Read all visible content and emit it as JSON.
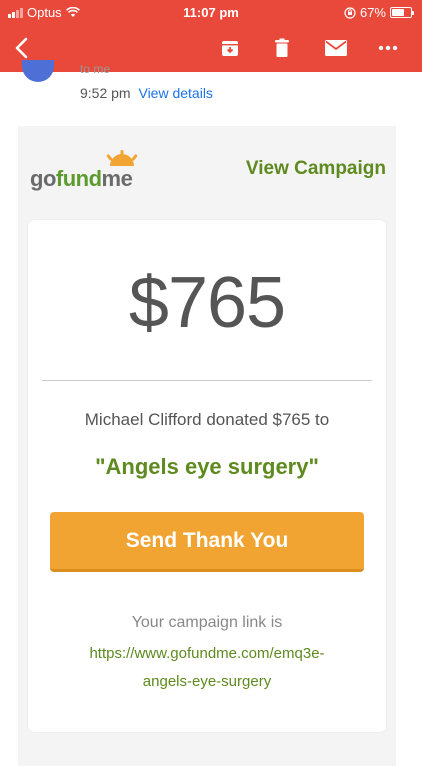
{
  "status_bar": {
    "carrier": "Optus",
    "time": "11:07 pm",
    "battery": "67%",
    "battery_level": 0.67
  },
  "toolbar": {
    "back_icon": "chevron-left-icon",
    "archive_icon": "archive-icon",
    "delete_icon": "trash-icon",
    "mark_icon": "envelope-icon",
    "more_icon": "more-icon"
  },
  "email_header": {
    "to_line": "to me",
    "time": "9:52 pm",
    "view_details": "View details"
  },
  "email_body": {
    "logo": "gofundme",
    "view_campaign": "View Campaign",
    "amount": "$765",
    "donation_text": "Michael Clifford donated $765 to",
    "campaign_name": "\"Angels eye surgery\"",
    "send_button": "Send Thank You",
    "link_label": "Your campaign link is",
    "link_line1": "https://www.gofundme.com/emq3e-",
    "link_line2": "angels-eye-surgery"
  },
  "colors": {
    "toolbar_red": "#e9493b",
    "brand_green": "#5e8a1f",
    "button_orange": "#f2a432"
  }
}
